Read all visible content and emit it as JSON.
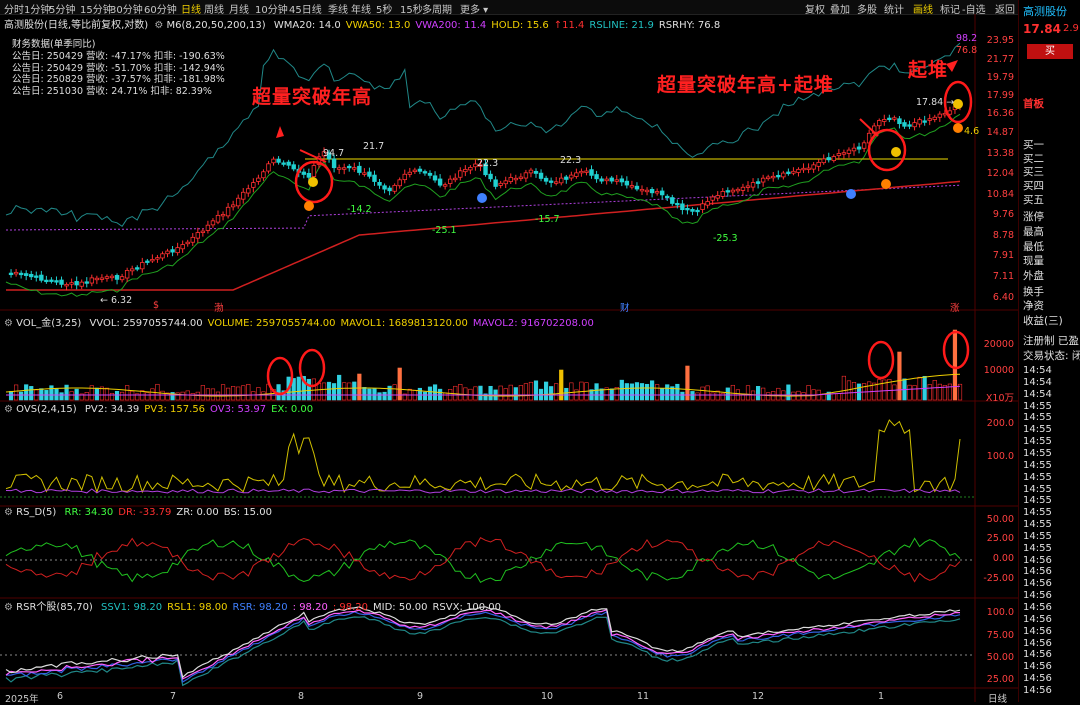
{
  "toolbar": {
    "left_items": [
      "分时",
      "1分钟",
      "5分钟",
      "15分钟",
      "30分钟",
      "60分钟",
      "日线",
      "周线",
      "月线",
      "10分钟",
      "45日线",
      "季线",
      "年线",
      "5秒",
      "15秒",
      "多周期",
      "更多"
    ],
    "active": "日线",
    "right_items": [
      "复权",
      "叠加",
      "多股",
      "统计",
      "画线",
      "标记",
      "-自选",
      "返回"
    ],
    "right_active": "画线"
  },
  "main_panel": {
    "title": "高测股份(日线,等比前复权,对数)",
    "indicator": "M6(8,20,50,200,13)",
    "values": [
      {
        "label": "WMA20: 14.0",
        "color": "#e0e0e0"
      },
      {
        "label": "VWA50: 13.0",
        "color": "#f0d000"
      },
      {
        "label": "VWA200: 11.4",
        "color": "#d040ff"
      },
      {
        "label": "HOLD: 15.6",
        "color": "#f0d000"
      },
      {
        "label": "↑11.4",
        "color": "#ff3030"
      },
      {
        "label": "RSLINE: 21.9",
        "color": "#20c0c0"
      },
      {
        "label": "RSRHY: 76.8",
        "color": "#e0e0e0"
      }
    ],
    "fin_title": "财务数据(单季同比)",
    "fin_rows": [
      "公告日: 250429  营收: -47.17%  扣非: -190.63%",
      "公告日: 250429  营收: -51.70%  扣非: -142.94%",
      "公告日: 250829  营收: -37.57%  扣非: -181.98%",
      "公告日: 251030  营收: 24.71%  扣非: 82.39%"
    ],
    "y_axis": [
      "23.95",
      "21.77",
      "19.79",
      "17.99",
      "16.36",
      "14.87",
      "13.38",
      "12.04",
      "10.84",
      "9.76",
      "8.78",
      "7.91",
      "7.11",
      "6.40"
    ],
    "data_labels": [
      {
        "text": "94.7",
        "color": "#ddd"
      },
      {
        "text": "21.7",
        "color": "#ddd"
      },
      {
        "text": "22.3",
        "color": "#ddd"
      },
      {
        "text": "22.3",
        "color": "#ddd"
      },
      {
        "text": "-14.2",
        "color": "#40ff40"
      },
      {
        "text": "-25.1",
        "color": "#40ff40"
      },
      {
        "text": "-15.7",
        "color": "#40ff40"
      },
      {
        "text": "-25.3",
        "color": "#40ff40"
      },
      {
        "text": "← 6.32",
        "color": "#ddd"
      },
      {
        "text": "17.84 →",
        "color": "#ddd"
      },
      {
        "text": "98.2",
        "color": "#d040ff"
      },
      {
        "text": "76.8",
        "color": "#ff4040"
      },
      {
        "text": "4.6",
        "color": "#f0d000"
      }
    ],
    "annotations": [
      "超量突破年高",
      "超量突破年高+起堆",
      "起堆"
    ],
    "markers": [
      "$",
      "渤",
      "财",
      "涨"
    ]
  },
  "vol_panel": {
    "title": "VOL_金(3,25)",
    "values": [
      {
        "label": "VVOL: 2597055744.00",
        "color": "#e0e0e0"
      },
      {
        "label": "VOLUME: 2597055744.00",
        "color": "#f0d000"
      },
      {
        "label": "MAVOL1: 1689813120.00",
        "color": "#f0d000"
      },
      {
        "label": "MAVOL2: 916702208.00",
        "color": "#d040ff"
      }
    ],
    "y_axis": [
      "20000",
      "10000"
    ],
    "unit": "X10万"
  },
  "ovs_panel": {
    "title": "OVS(2,4,15)",
    "values": [
      {
        "label": "PV2: 34.39",
        "color": "#e0e0e0"
      },
      {
        "label": "PV3: 157.56",
        "color": "#f0d000"
      },
      {
        "label": "OV3: 53.97",
        "color": "#d040ff"
      },
      {
        "label": "EX: 0.00",
        "color": "#40ff40"
      }
    ],
    "y_axis": [
      "200.0",
      "100.0"
    ]
  },
  "rs_panel": {
    "title": "RS_D(5)",
    "values": [
      {
        "label": "RR: 34.30",
        "color": "#40ff40"
      },
      {
        "label": "DR: -33.79",
        "color": "#ff3030"
      },
      {
        "label": "ZR: 0.00",
        "color": "#e0e0e0"
      },
      {
        "label": "BS: 15.00",
        "color": "#e0e0e0"
      }
    ],
    "y_axis": [
      "50.00",
      "25.00",
      "0.00",
      "-25.00"
    ]
  },
  "rsr_panel": {
    "title": "RSR个股(85,70)",
    "values": [
      {
        "label": "SSV1: 98.20",
        "color": "#20c0c0"
      },
      {
        "label": "RSL1: 98.00",
        "color": "#f0d000"
      },
      {
        "label": "RSR: 98.20",
        "color": "#4080ff"
      },
      {
        "label": ": 98.20",
        "color": "#ff60ff"
      },
      {
        "label": ": 98.20",
        "color": "#ff3030"
      },
      {
        "label": "MID: 50.00",
        "color": "#e0e0e0"
      },
      {
        "label": "RSVX: 100.00",
        "color": "#e0e0e0"
      }
    ],
    "y_axis": [
      "100.0",
      "75.00",
      "50.00",
      "25.00"
    ]
  },
  "x_axis": [
    "2025年",
    "6",
    "7",
    "8",
    "9",
    "10",
    "11",
    "12",
    "1"
  ],
  "x_axis_right": "日线",
  "right_panel": {
    "title": "高测股份",
    "price": "17.84",
    "change": "2.9",
    "buy_button": "买",
    "sub": "首板",
    "rows": [
      "买一",
      "买二",
      "买三",
      "买四",
      "买五",
      "涨停",
      "最高",
      "最低",
      "现量",
      "外盘",
      "换手",
      "净资",
      "收益(三)",
      "注册制 已盈",
      "交易状态: 闭"
    ],
    "times": [
      "14:54",
      "14:54",
      "14:54",
      "14:55",
      "14:55",
      "14:55",
      "14:55",
      "14:55",
      "14:55",
      "14:55",
      "14:55",
      "14:55",
      "14:55",
      "14:55",
      "14:55",
      "14:55",
      "14:56",
      "14:56",
      "14:56",
      "14:56",
      "14:56",
      "14:56",
      "14:56",
      "14:56",
      "14:56",
      "14:56",
      "14:56",
      "14:56"
    ]
  }
}
